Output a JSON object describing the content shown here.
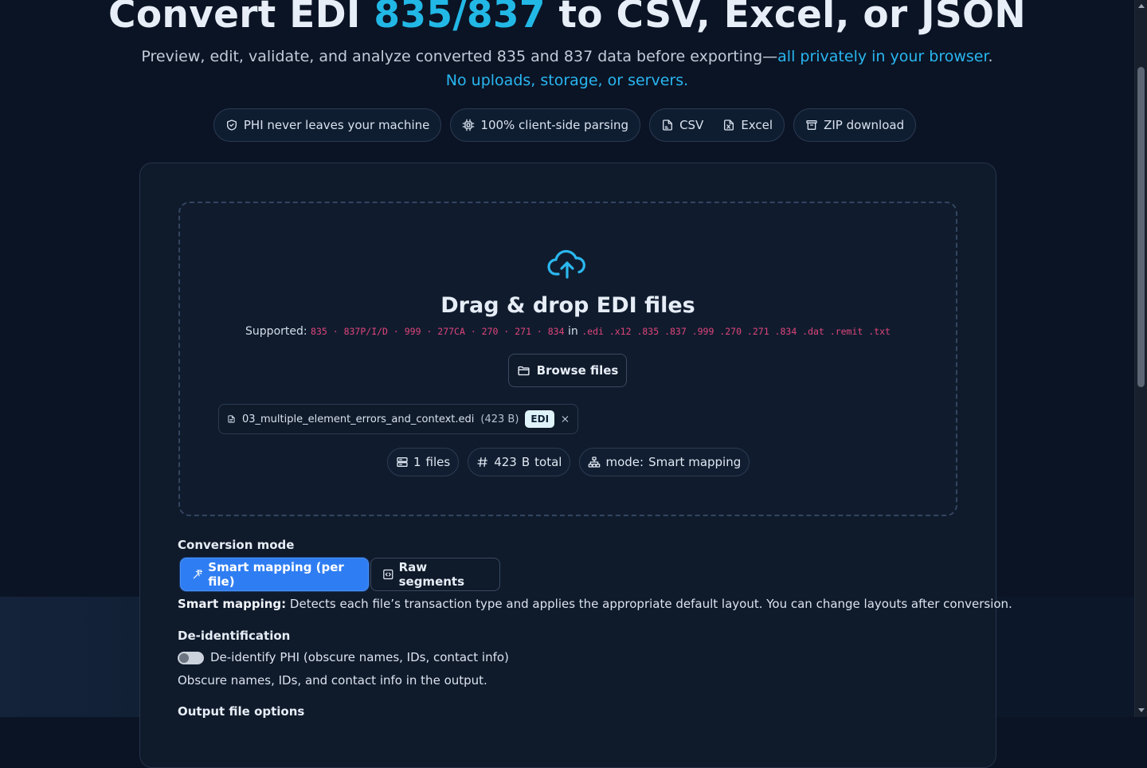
{
  "hero": {
    "title_pre": "Convert EDI ",
    "title_accent": "835/837",
    "title_post": " to CSV, Excel, or JSON",
    "subtitle_plain": "Preview, edit, validate, and analyze converted 835 and 837 data before exporting—",
    "subtitle_highlight_1": "all privately in your browser",
    "subtitle_period": ".",
    "subtitle_highlight_2": "No uploads, storage, or servers."
  },
  "chips": {
    "phi": "PHI never leaves your machine",
    "client_side": "100% client-side parsing",
    "csv": "CSV",
    "excel": "Excel",
    "zip": "ZIP download"
  },
  "dropzone": {
    "title": "Drag & drop EDI files",
    "supported_label": "Supported:",
    "supported_types": "835 · 837P/I/D · 999 · 277CA · 270 · 271 · 834",
    "in_word": "in",
    "supported_exts": ".edi .x12 .835 .837 .999 .270 .271 .834 .dat .remit .txt",
    "browse_label": "Browse files"
  },
  "file": {
    "name": "03_multiple_element_errors_and_context.edi",
    "size": "(423 B)",
    "badge": "EDI"
  },
  "stats": {
    "files_count": "1",
    "files_label": "files",
    "total_size": "423",
    "total_unit": "B",
    "total_label": "total",
    "mode_label": "mode:",
    "mode_value": "Smart mapping"
  },
  "conversion": {
    "heading": "Conversion mode",
    "smart_button": "Smart mapping (per file)",
    "raw_button": "Raw segments",
    "desc_bold": "Smart mapping:",
    "desc_text": " Detects each file’s transaction type and applies the appropriate default layout. You can change layouts after conversion."
  },
  "deid": {
    "heading": "De-identification",
    "toggle_label": "De-identify PHI (obscure names, IDs, contact info)",
    "toggle_on": false,
    "description": "Obscure names, IDs, and contact info in the output."
  },
  "output": {
    "heading": "Output file options"
  },
  "colors": {
    "accent": "#22b8e6",
    "primary_button": "#2f7df2",
    "background": "#0b1424",
    "pink_code": "#e0447a"
  }
}
